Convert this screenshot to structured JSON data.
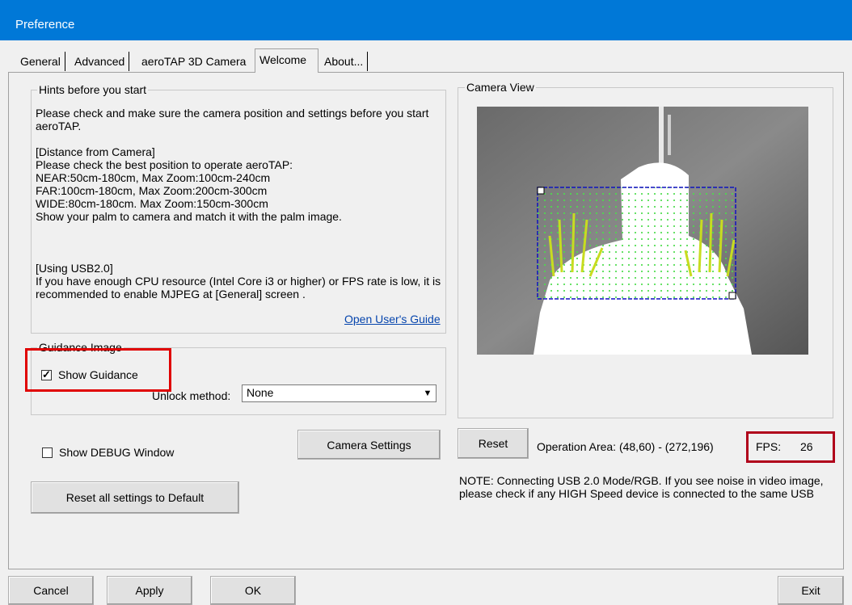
{
  "window": {
    "title": "Preference"
  },
  "tabs": [
    {
      "label": "General"
    },
    {
      "label": "Advanced"
    },
    {
      "label": "aeroTAP 3D Camera"
    },
    {
      "label": "Welcome"
    },
    {
      "label": "About..."
    }
  ],
  "active_tab": "Welcome",
  "hints": {
    "legend": "Hints before you start",
    "para1": "Please check and make sure the camera position and settings before you start aeroTAP.",
    "para2": "[Distance from Camera]\nPlease check the best position to operate aeroTAP:\nNEAR:50cm-180cm, Max Zoom:100cm-240cm\nFAR:100cm-180cm, Max Zoom:200cm-300cm\nWIDE:80cm-180cm. Max Zoom:150cm-300cm\nShow your palm to camera and match it with the palm image.",
    "para3": "[Using USB2.0]\nIf you have enough CPU resource (Intel Core i3 or higher) or FPS rate is low, it is recommended to enable MJPEG at [General] screen .",
    "guide_link": "Open User's Guide"
  },
  "guidance": {
    "legend": "Guidance Image",
    "show_guidance_label": "Show Guidance",
    "show_guidance_checked": true,
    "unlock_label": "Unlock method:",
    "unlock_value": "None"
  },
  "debug": {
    "label": "Show DEBUG Window",
    "checked": false
  },
  "buttons": {
    "camera_settings": "Camera Settings",
    "reset_all": "Reset all settings to Default",
    "reset": "Reset",
    "cancel": "Cancel",
    "apply": "Apply",
    "ok": "OK",
    "exit": "Exit"
  },
  "camera_view": {
    "legend": "Camera View",
    "operation_area": "Operation Area: (48,60) - (272,196)",
    "fps_label": "FPS:",
    "fps_value": "26",
    "note": "NOTE: Connecting USB 2.0 Mode/RGB. If you see noise in video image, please check if any HIGH Speed device is connected to the same USB"
  },
  "colors": {
    "titlebar": "#0078d7",
    "highlight": "#e00000",
    "link": "#0645ad"
  }
}
